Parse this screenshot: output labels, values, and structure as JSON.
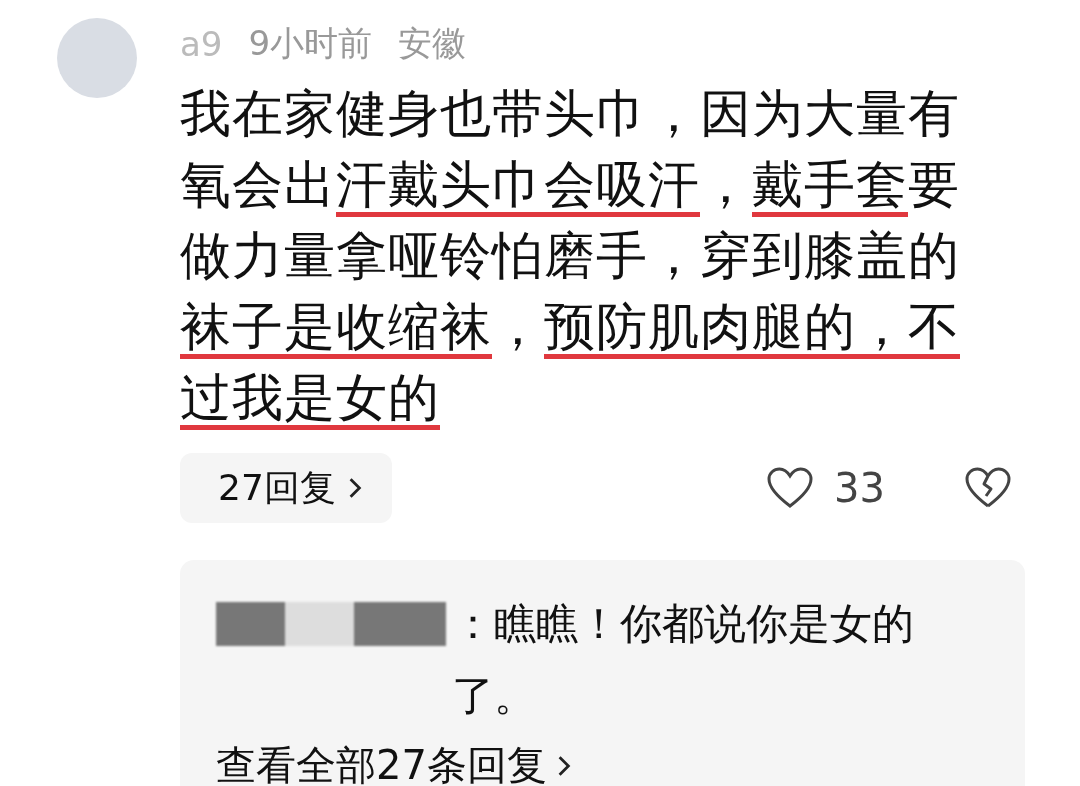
{
  "comment": {
    "username": "a9",
    "time": "9小时前",
    "location": "安徽",
    "segments": [
      {
        "text": "我在家健身也带头巾，因为大量有氧会出",
        "underlined": false
      },
      {
        "text": "汗戴头巾会吸汗",
        "underlined": true
      },
      {
        "text": "，",
        "underlined": false
      },
      {
        "text": "戴手套",
        "underlined": true
      },
      {
        "text": "要做力量拿哑铃怕磨手，穿到膝盖的",
        "underlined": false
      },
      {
        "text": "袜子是收缩袜",
        "underlined": true
      },
      {
        "text": "，",
        "underlined": false
      },
      {
        "text": "预防肌肉腿的，不过我是女的",
        "underlined": true
      }
    ],
    "reply_count": "27回复",
    "likes": "33",
    "liked": false
  },
  "reply_preview": {
    "text": "：瞧瞧！你都说你是女的了。",
    "view_all": "查看全部27条回复"
  }
}
